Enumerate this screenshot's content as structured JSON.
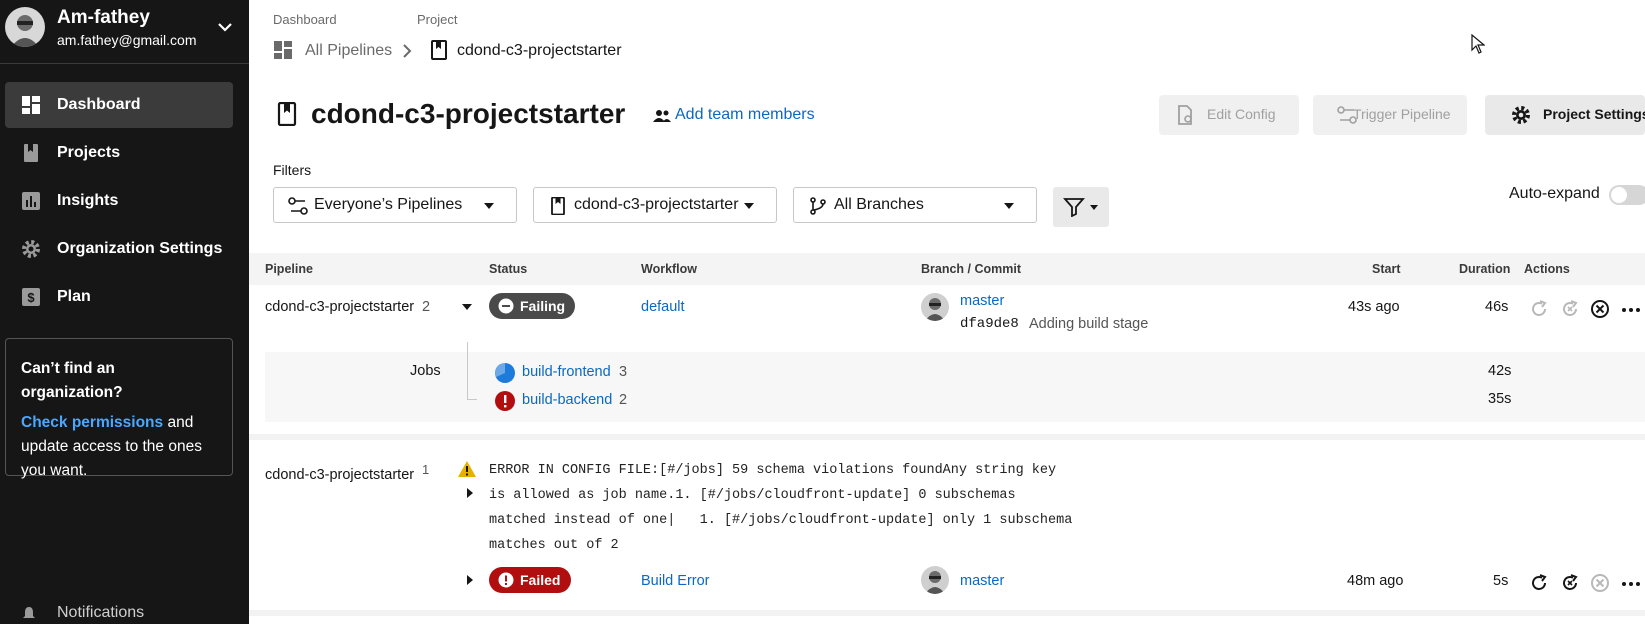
{
  "user": {
    "name": "Am-fathey",
    "email": "am.fathey@gmail.com"
  },
  "sidebar": {
    "items": [
      {
        "label": "Dashboard",
        "icon": "dashboard-icon",
        "active": true
      },
      {
        "label": "Projects",
        "icon": "project-icon",
        "active": false
      },
      {
        "label": "Insights",
        "icon": "insights-icon",
        "active": false
      },
      {
        "label": "Organization Settings",
        "icon": "gear-icon",
        "active": false
      },
      {
        "label": "Plan",
        "icon": "dollar-icon",
        "active": false
      }
    ],
    "org_card": {
      "title": "Can’t find an organization?",
      "link": "Check permissions",
      "text_after_link": " and update access to the ones you want."
    },
    "notifications": "Notifications"
  },
  "breadcrumb": {
    "dashboard_label": "Dashboard",
    "project_label": "Project",
    "pipelines": "All Pipelines",
    "project": "cdond-c3-projectstarter"
  },
  "header": {
    "title": "cdond-c3-projectstarter",
    "add_team": "Add team members",
    "edit_config": "Edit Config",
    "trigger_pipeline": "Trigger Pipeline",
    "project_settings": "Project Settings"
  },
  "filters": {
    "label": "Filters",
    "pipelines": "Everyone’s Pipelines",
    "project": "cdond-c3-projectstarter",
    "branches": "All Branches",
    "auto_expand": "Auto-expand"
  },
  "table": {
    "headers": {
      "pipeline": "Pipeline",
      "status": "Status",
      "workflow": "Workflow",
      "branch_commit": "Branch / Commit",
      "start": "Start",
      "duration": "Duration",
      "actions": "Actions"
    },
    "rows": [
      {
        "pipeline": "cdond-c3-projectstarter",
        "number": "2",
        "status": "Failing",
        "workflow": "default",
        "branch": "master",
        "commit_hash": "dfa9de8",
        "commit_msg": "Adding build stage",
        "start": "43s ago",
        "duration": "46s",
        "jobs_label": "Jobs",
        "jobs": [
          {
            "name": "build-frontend",
            "number": "3",
            "duration": "42s",
            "state": "running"
          },
          {
            "name": "build-backend",
            "number": "2",
            "duration": "35s",
            "state": "failed"
          }
        ]
      },
      {
        "pipeline": "cdond-c3-projectstarter",
        "number": "1",
        "error_lines": [
          "ERROR IN CONFIG FILE:[#/jobs] 59 schema violations foundAny string key",
          "is allowed as job name.1. [#/jobs/cloudfront-update] 0 subschemas",
          "matched instead of one|   1. [#/jobs/cloudfront-update] only 1 subschema",
          "matches out of 2"
        ],
        "status": "Failed",
        "workflow": "Build Error",
        "branch": "master",
        "start": "48m ago",
        "duration": "5s"
      }
    ]
  },
  "colors": {
    "failed": "#b10f0f",
    "failing": "#4a4a4a",
    "link": "#0b68c4",
    "sidebar": "#161616",
    "running": "#1f7bd9",
    "warning": "#e5b100"
  }
}
